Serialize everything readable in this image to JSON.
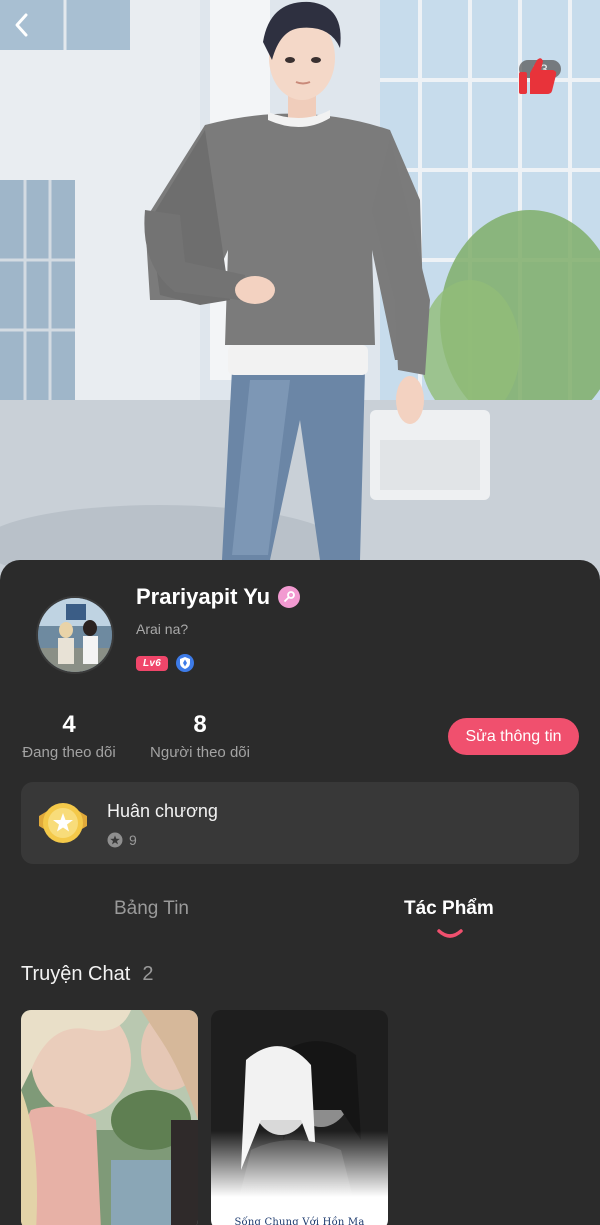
{
  "header": {
    "back_icon": "chevron-left-icon",
    "like_icon": "thumbs-up-icon",
    "like_count": "13",
    "like_color": "#e8333a"
  },
  "profile": {
    "name": "Prariyapit Yu",
    "bio": "Arai na?",
    "level_badge": "Lv6",
    "verified_icon": "key-badge-icon",
    "shield_icon": "shield-badge-icon"
  },
  "stats": {
    "following_count": "4",
    "following_label": "Đang theo dõi",
    "followers_count": "8",
    "followers_label": "Người theo dõi"
  },
  "actions": {
    "edit_label": "Sửa thông tin",
    "accent_color": "#f0506e"
  },
  "medals": {
    "title": "Huân chương",
    "count": "9"
  },
  "tabs": [
    {
      "label": "Bảng Tin",
      "active": false
    },
    {
      "label": "Tác Phẩm",
      "active": true
    }
  ],
  "works": {
    "section_title": "Truyện Chat",
    "count": "2",
    "stories": [
      {
        "title": ""
      },
      {
        "title": "Sống Chung Với Hồn Ma"
      }
    ]
  }
}
